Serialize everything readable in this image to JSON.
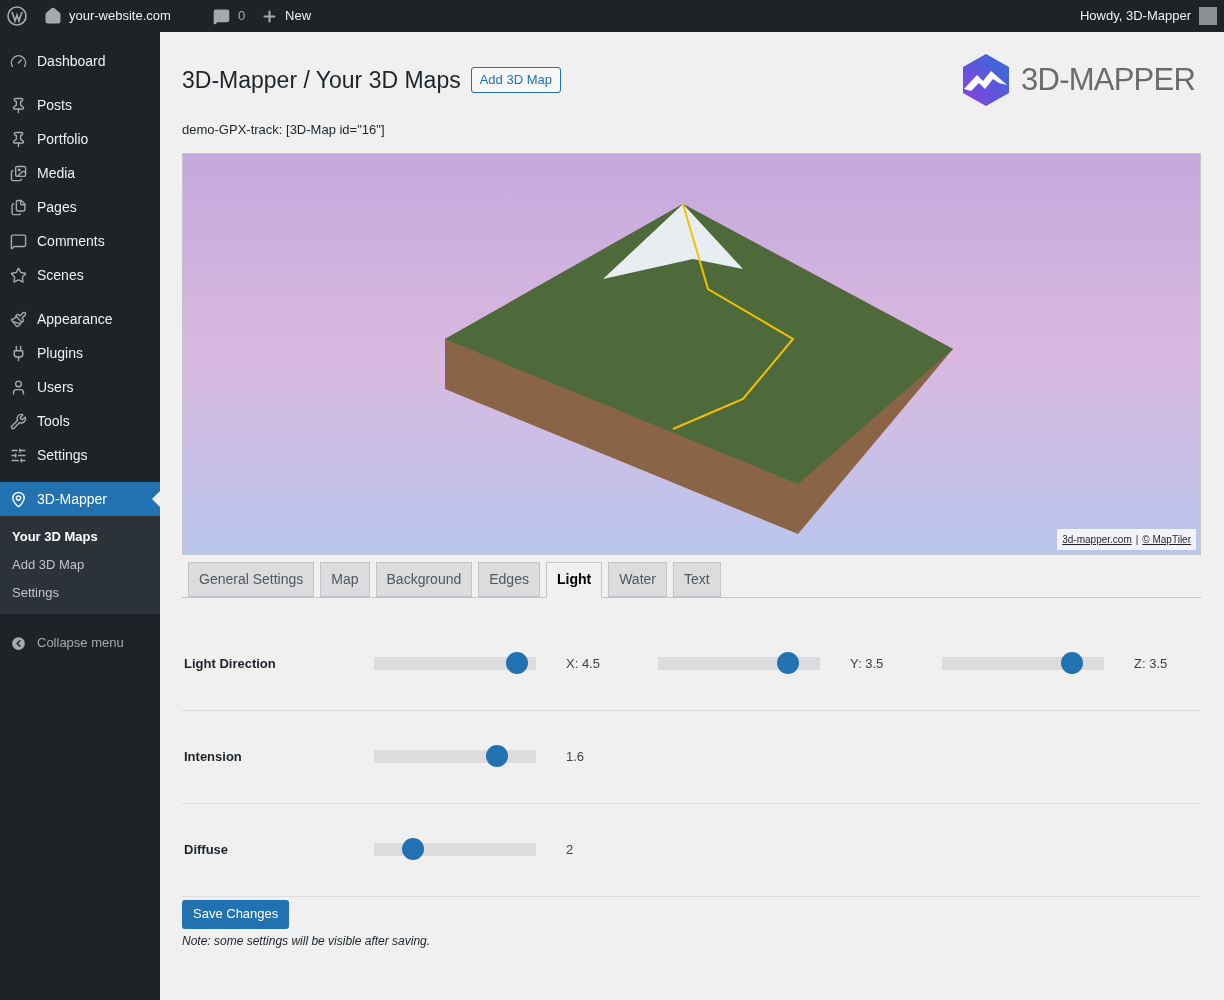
{
  "admin_bar": {
    "site": "your-website.com",
    "comments_count": "0",
    "new": "New",
    "greeting": "Howdy, 3D-Mapper"
  },
  "sidebar": {
    "groups": [
      [
        {
          "label": "Dashboard",
          "selected": false
        }
      ],
      [
        {
          "label": "Posts",
          "selected": false
        },
        {
          "label": "Portfolio",
          "selected": false
        },
        {
          "label": "Media",
          "selected": false
        },
        {
          "label": "Pages",
          "selected": false
        },
        {
          "label": "Comments",
          "selected": false
        },
        {
          "label": "Scenes",
          "selected": false
        }
      ],
      [
        {
          "label": "Appearance",
          "selected": false
        },
        {
          "label": "Plugins",
          "selected": false
        },
        {
          "label": "Users",
          "selected": false
        },
        {
          "label": "Tools",
          "selected": false
        },
        {
          "label": "Settings",
          "selected": false
        }
      ],
      [
        {
          "label": "3D-Mapper",
          "selected": true,
          "children": [
            {
              "label": "Your 3D Maps",
              "selected": true
            },
            {
              "label": "Add 3D Map",
              "selected": false
            },
            {
              "label": "Settings",
              "selected": false
            }
          ]
        }
      ]
    ],
    "collapse": "Collapse menu"
  },
  "page": {
    "title": "3D-Mapper / Your 3D Maps",
    "add_button": "Add 3D Map",
    "logo_text": "3D-MAPPER",
    "shortcode": "demo-GPX-track: [3D-Map id=\"16\"]",
    "map_attribution": [
      "3d-mapper.com",
      "|",
      "© MapTiler"
    ]
  },
  "tabs": [
    {
      "label": "General Settings",
      "selected": false
    },
    {
      "label": "Map",
      "selected": false
    },
    {
      "label": "Background",
      "selected": false
    },
    {
      "label": "Edges",
      "selected": false
    },
    {
      "label": "Light",
      "selected": true
    },
    {
      "label": "Water",
      "selected": false
    },
    {
      "label": "Text",
      "selected": false
    }
  ],
  "settings": [
    {
      "label": "Light Direction",
      "sliders": [
        {
          "level": 0.88,
          "reading": "X: 4.5"
        },
        {
          "level": 0.8,
          "reading": "Y: 3.5"
        },
        {
          "level": 0.8,
          "reading": "Z: 3.5"
        }
      ]
    },
    {
      "label": "Intension",
      "sliders": [
        {
          "level": 0.76,
          "reading": "1.6"
        }
      ]
    },
    {
      "label": "Diffuse",
      "sliders": [
        {
          "level": 0.24,
          "reading": "2"
        }
      ]
    }
  ],
  "save_button": "Save Changes",
  "note": "Note: some settings will be visible after saving."
}
